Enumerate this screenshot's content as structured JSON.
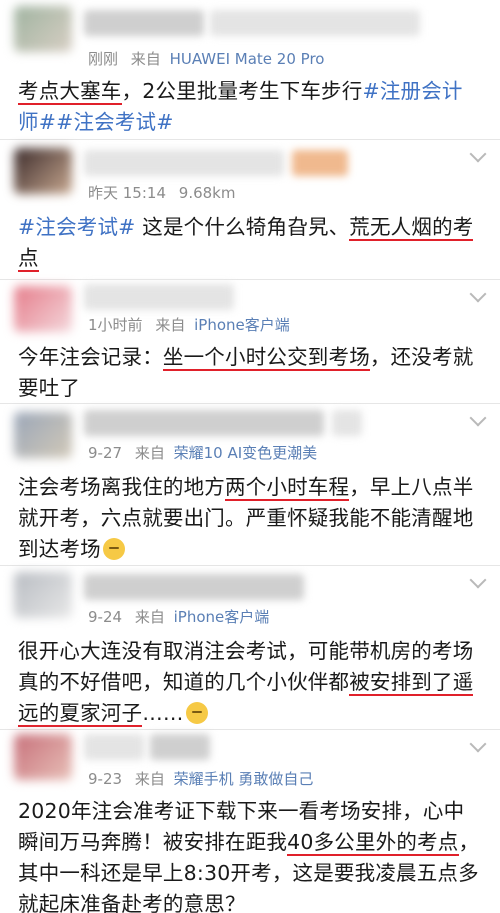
{
  "posts": [
    {
      "meta_time": "刚刚",
      "meta_from": "来自",
      "meta_source": "HUAWEI Mate 20 Pro",
      "segments": [
        {
          "t": "考点大塞车",
          "ul": true
        },
        {
          "t": "，2公里批量考生下车步行"
        },
        {
          "t": "#注册会计师##注会考试#",
          "link": true
        }
      ]
    },
    {
      "meta_time": "昨天 15:14",
      "meta_from": "9.68km",
      "meta_source": "",
      "segments": [
        {
          "t": "#注会考试#",
          "link": true
        },
        {
          "t": " 这是个什么犄角旮旯、"
        },
        {
          "t": "荒无人烟的考点",
          "ul": true
        }
      ]
    },
    {
      "meta_time": "1小时前",
      "meta_from": "来自",
      "meta_source": "iPhone客户端",
      "segments": [
        {
          "t": "今年注会记录："
        },
        {
          "t": "坐一个小时公交到考场",
          "ul": true
        },
        {
          "t": "，还没考就要吐了"
        }
      ]
    },
    {
      "meta_time": "9-27",
      "meta_from": "来自",
      "meta_source": "荣耀10 AI变色更潮美",
      "segments": [
        {
          "t": "注会考场离我住的地方"
        },
        {
          "t": "两个小时车程",
          "ul": true
        },
        {
          "t": "，早上八点半就开考，六点就要出门。严重怀疑我能不能清醒地到达考场"
        },
        {
          "emoji": "sleepy-face"
        }
      ]
    },
    {
      "meta_time": "9-24",
      "meta_from": "来自",
      "meta_source": "iPhone客户端",
      "segments": [
        {
          "t": "很开心大连没有取消注会考试，可能带机房的考场真的不好借吧，知道的几个小伙伴都"
        },
        {
          "t": "被安排到了遥远的夏家河子",
          "ul": true
        },
        {
          "t": "……"
        },
        {
          "emoji": "tears-of-joy-face"
        }
      ]
    },
    {
      "meta_time": "9-23",
      "meta_from": "来自",
      "meta_source": "荣耀手机 勇敢做自己",
      "segments": [
        {
          "t": "2020年注会准考证下载下来一看考场安排，心中瞬间万马奔腾！被安排在距我"
        },
        {
          "t": "40多公里外的考点",
          "ul": true
        },
        {
          "t": "，其中一科还是早上8:30开考，这是要我凌晨五点多就起床准备赴考的意思？"
        }
      ]
    }
  ],
  "colors": {
    "source_link": "#5a7fb5",
    "topic_link": "#3f72c4",
    "underline": "#e0202a"
  }
}
